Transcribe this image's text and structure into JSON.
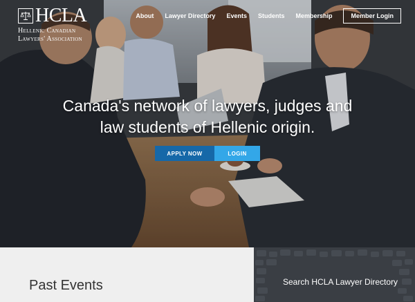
{
  "brand": {
    "logo_text": "HCLA",
    "org_name_line1": "Hellenic Canadian",
    "org_name_line2": "Lawyers' Association",
    "logo_icon": "scales-of-justice-icon"
  },
  "nav": {
    "items": [
      "About",
      "Lawyer Directory",
      "Events",
      "Students",
      "Membership"
    ],
    "login": "Member Login"
  },
  "hero": {
    "headline_line1": "Canada's network of lawyers, judges and",
    "headline_line2": "law students of Hellenic origin.",
    "apply_label": "APPLY NOW",
    "login_label": "LOGIN"
  },
  "sections": {
    "past_events_title": "Past Events",
    "search_title": "Search HCLA Lawyer Directory"
  },
  "colors": {
    "apply": "#1668a8",
    "login": "#33a7e8",
    "panel_left": "#efefef",
    "panel_right": "#3b3f45"
  }
}
